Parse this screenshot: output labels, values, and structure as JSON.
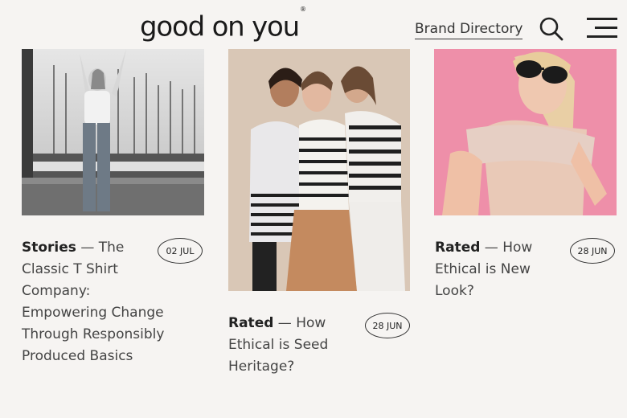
{
  "header": {
    "logo": "good on you",
    "logo_mark": "®",
    "brand_directory": "Brand Directory",
    "search_icon": "search-icon",
    "menu_icon": "hamburger-icon"
  },
  "articles": [
    {
      "category": "Stories",
      "title": " — The Classic T Shirt Company: Empowering Change Through Responsibly Produced Basics",
      "date": "02 JUL",
      "image": "black-and-white photo of woman with arms raised at marina"
    },
    {
      "category": "Rated",
      "title": " — How Ethical is Seed Heritage?",
      "date": "28 JUN",
      "image": "three women in striped tops posing together"
    },
    {
      "category": "Rated",
      "title": " — How Ethical is New Look?",
      "date": "28 JUN",
      "image": "woman in sunglasses and pink top on pink background"
    }
  ],
  "colors": {
    "background": "#f6f4f2",
    "text": "#444444",
    "accent_pink": "#ee8fa9"
  }
}
